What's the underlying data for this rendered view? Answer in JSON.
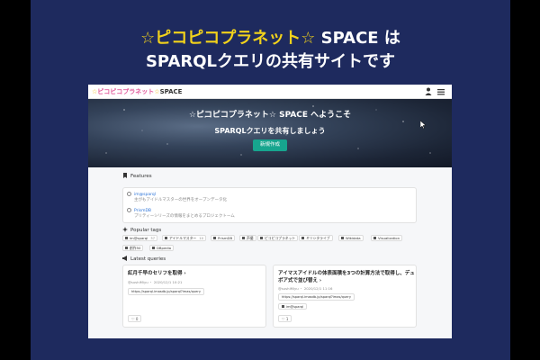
{
  "slide": {
    "title_line1_accent_a": "☆ピコピコプラネット☆",
    "title_line1_rest": " SPACE は",
    "title_line2": "SPARQLクエリの共有サイトです"
  },
  "app": {
    "logo_part1": "☆",
    "logo_part2": "ピコピコプラネット",
    "logo_part3": "☆",
    "logo_part4": "SPACE"
  },
  "hero": {
    "title": "☆ピコピコプラネット☆ SPACE へようこそ",
    "subtitle": "SPARQLクエリを共有しましょう",
    "button_label": "新規作成"
  },
  "features": {
    "heading": "Features",
    "items": [
      {
        "link": "im@sparql",
        "desc": "主がもアイドルマスターの世界をオープンデータ化"
      },
      {
        "link": "PrismDB",
        "desc": "プリティーシリーズの情報をまとめるプロジェクトーム"
      }
    ]
  },
  "popular_tags": {
    "heading": "Popular tags",
    "items": [
      {
        "name": "im@sparql",
        "count": "37"
      },
      {
        "name": "アイドルマスター",
        "count": "10"
      },
      {
        "name": "PrismDB",
        "count": ""
      },
      {
        "name": "声優",
        "count": ""
      },
      {
        "name": "ピコピコプラネット",
        "count": ""
      },
      {
        "name": "ミリシタライブ",
        "count": ""
      },
      {
        "name": "Wikidata",
        "count": ""
      },
      {
        "name": "Visualization",
        "count": ""
      },
      {
        "name": "創作50",
        "count": ""
      },
      {
        "name": "DBpedia",
        "count": ""
      }
    ]
  },
  "latest_queries": {
    "heading": "Latest queries",
    "items": [
      {
        "title": "紅月千早のセリフを取得 ›",
        "meta": "@sushiMiyu ・ 2020/12/1 10:21",
        "url": "https://sparql.imasdb.jp/sparql?imas/query",
        "tag": "",
        "likes": "0"
      },
      {
        "title": "アイマスアイドルの体表面積を3つの計算方法で取得し、デュボア式で並び替え ›",
        "meta": "@sushiMiyu ・ 2020/12/1 11:16",
        "url": "https://sparql.imasdb.jp/sparql?imas/query",
        "tag": "im@sparql",
        "likes": "1"
      }
    ]
  },
  "colors": {
    "slide_bg": "#1e2a5e",
    "accent_yellow": "#f2d21b",
    "button_teal": "#17a58e",
    "link_blue": "#2b73d8"
  }
}
